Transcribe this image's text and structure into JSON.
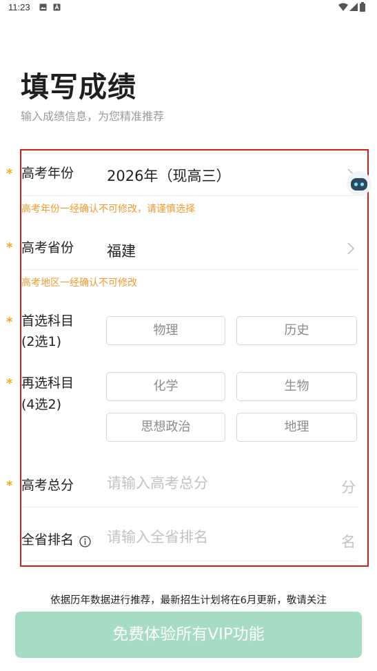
{
  "status_bar": {
    "time": "11:23"
  },
  "header": {
    "title": "填写成绩",
    "subtitle": "输入成绩信息，为您精准推荐"
  },
  "form": {
    "exam_year": {
      "label": "高考年份",
      "value": "2026年（现高三）",
      "hint": "高考年份一经确认不可修改，请谨慎选择",
      "required": "*"
    },
    "province": {
      "label": "高考省份",
      "value": "福建",
      "hint": "高考地区一经确认不可修改",
      "required": "*"
    },
    "first_subject": {
      "label_line1": "首选科目",
      "label_line2": "(2选1)",
      "required": "*",
      "options": [
        "物理",
        "历史"
      ]
    },
    "second_subject": {
      "label_line1": "再选科目",
      "label_line2": "(4选2)",
      "required": "*",
      "options": [
        "化学",
        "生物",
        "思想政治",
        "地理"
      ]
    },
    "total_score": {
      "label": "高考总分",
      "placeholder": "请输入高考总分",
      "unit": "分",
      "required": "*"
    },
    "rank": {
      "label": "全省排名",
      "placeholder": "请输入全省排名",
      "unit": "名"
    }
  },
  "footer": {
    "notice": "依据历年数据进行推荐，最新招生计划将在6月更新，敬请关注",
    "cta_label": "免费体验所有VIP功能"
  },
  "colors": {
    "accent_orange": "#f5a623",
    "cta_green": "#a6dcc3",
    "highlight_border": "#d71a1a"
  }
}
